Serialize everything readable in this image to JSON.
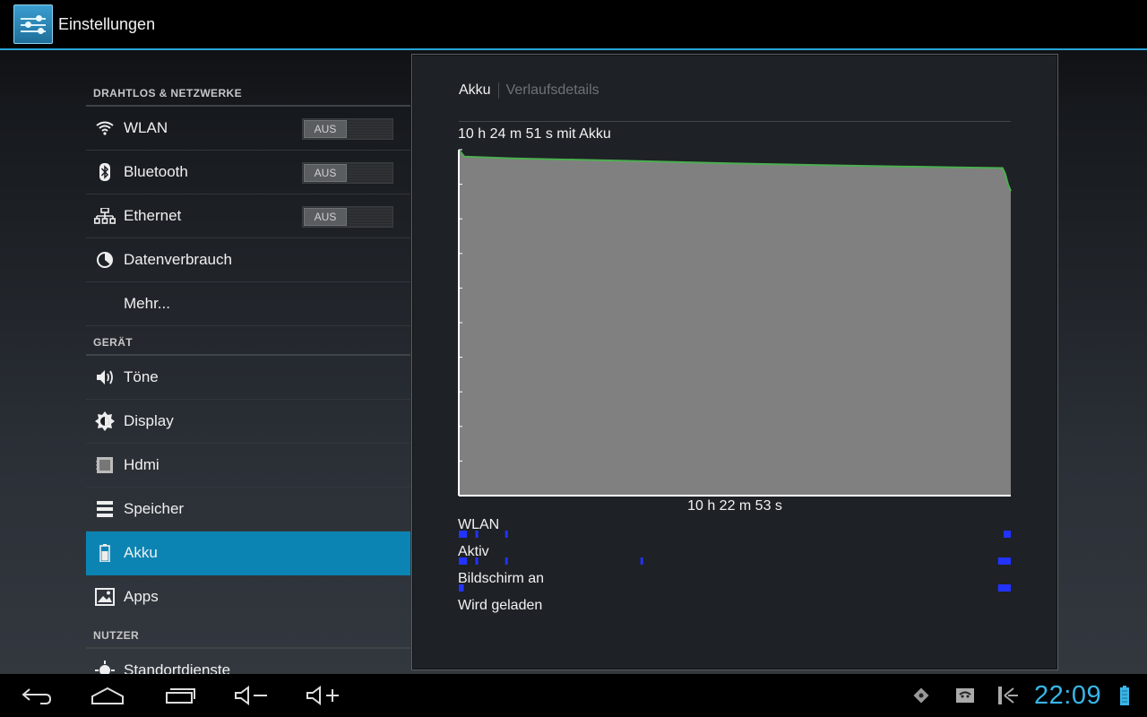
{
  "action_bar": {
    "title": "Einstellungen",
    "app_icon": "settings-sliders-icon"
  },
  "settings": {
    "section_wireless": "DRAHTLOS & NETZWERKE",
    "wlan": {
      "label": "WLAN",
      "icon": "wifi-icon",
      "toggle": "AUS"
    },
    "bluetooth": {
      "label": "Bluetooth",
      "icon": "bluetooth-icon",
      "toggle": "AUS"
    },
    "ethernet": {
      "label": "Ethernet",
      "icon": "ethernet-icon",
      "toggle": "AUS"
    },
    "data_usage": {
      "label": "Datenverbrauch",
      "icon": "data-usage-icon"
    },
    "more": {
      "label": "Mehr..."
    },
    "section_device": "GERÄT",
    "sound": {
      "label": "Töne",
      "icon": "speaker-icon"
    },
    "display": {
      "label": "Display",
      "icon": "brightness-icon"
    },
    "hdmi": {
      "label": "Hdmi",
      "icon": "hdmi-icon"
    },
    "storage": {
      "label": "Speicher",
      "icon": "storage-icon"
    },
    "battery": {
      "label": "Akku",
      "icon": "battery-icon",
      "selected": true
    },
    "apps": {
      "label": "Apps",
      "icon": "apps-icon"
    },
    "section_user": "NUTZER",
    "location": {
      "label": "Standortdienste",
      "icon": "location-icon"
    }
  },
  "detail": {
    "breadcrumb_active": "Akku",
    "breadcrumb_inactive": "Verlaufsdetails",
    "duration": "10 h 24 m 51 s mit Akku",
    "state_labels": {
      "wlan": "WLAN",
      "awake": "Aktiv",
      "screen_on": "Bildschirm an",
      "charging": "Wird geladen"
    }
  },
  "chart_data": {
    "type": "area",
    "title": "10 h 24 m 51 s mit Akku",
    "x_label": "10 h 22 m 53 s",
    "ylim": [
      0,
      100
    ],
    "series": [
      {
        "x": [
          0,
          0.01,
          0.1,
          0.3,
          0.5,
          0.7,
          0.9,
          0.985,
          0.99,
          0.995,
          1.0
        ],
        "values": [
          100,
          98,
          97.5,
          96.8,
          96,
          95.4,
          94.9,
          94.7,
          93,
          90,
          88
        ]
      }
    ],
    "fill_color": "#808080",
    "line_color": "#4caf50",
    "state_tracks": [
      {
        "name": "WLAN",
        "segments": [
          [
            0.0,
            0.015
          ],
          [
            0.03,
            0.035
          ],
          [
            0.084,
            0.088
          ],
          [
            0.987,
            1.0
          ]
        ]
      },
      {
        "name": "Aktiv",
        "segments": [
          [
            0.0,
            0.015
          ],
          [
            0.03,
            0.035
          ],
          [
            0.084,
            0.088
          ],
          [
            0.329,
            0.333
          ],
          [
            0.977,
            1.0
          ]
        ]
      },
      {
        "name": "Bildschirm an",
        "segments": [
          [
            0.0,
            0.009
          ],
          [
            0.977,
            1.0
          ]
        ]
      },
      {
        "name": "Wird geladen",
        "segments": []
      }
    ],
    "track_color": "#2233ff"
  },
  "navigation": {
    "back_icon": "back-icon",
    "home_icon": "home-icon",
    "recents_icon": "recent-apps-icon",
    "volume_down_icon": "volume-down-icon",
    "volume_up_icon": "volume-up-icon"
  },
  "status_bar": {
    "clock": "22:09",
    "icons": [
      "puzzle-notification-icon",
      "usb-debug-icon",
      "storage-notification-icon",
      "battery-status-icon"
    ],
    "accent": "#33b5e5"
  }
}
